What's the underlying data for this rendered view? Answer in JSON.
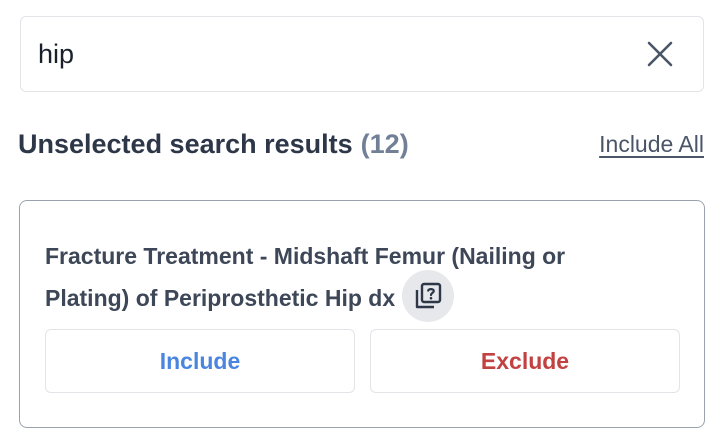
{
  "search": {
    "value": "hip",
    "clear_icon": "close-icon"
  },
  "results_header": {
    "title": "Unselected search results",
    "count": "(12)",
    "include_all_label": "Include All"
  },
  "results": [
    {
      "title": "Fracture Treatment - Midshaft Femur (Nailing or Plating) of Periprosthetic Hip dx",
      "info_icon": "copy-question-icon",
      "include_label": "Include",
      "exclude_label": "Exclude"
    }
  ],
  "colors": {
    "include": "#4a86e0",
    "exclude": "#c24141",
    "count": "#718096"
  }
}
